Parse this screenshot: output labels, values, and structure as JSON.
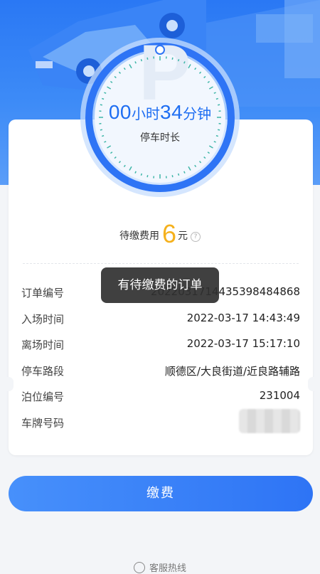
{
  "parking": {
    "duration_hours": "00",
    "duration_hours_unit": "小时",
    "duration_minutes": "34",
    "duration_minutes_unit": "分钟",
    "duration_label": "停车时长"
  },
  "fee": {
    "label": "待缴费用",
    "amount": "6",
    "unit": "元",
    "help_icon": "question-circle-icon"
  },
  "order": {
    "rows": [
      {
        "label": "订单编号",
        "value": "20220317144353984848​68"
      },
      {
        "label": "入场时间",
        "value": "2022-03-17 14:43:49"
      },
      {
        "label": "离场时间",
        "value": "2022-03-17 15:17:10"
      },
      {
        "label": "停车路段",
        "value": "顺德区/大良街道/近良路辅路"
      },
      {
        "label": "泊位编号",
        "value": "231004"
      },
      {
        "label": "车牌号码",
        "value": ""
      }
    ]
  },
  "toast": {
    "text": "有待缴费的订单"
  },
  "actions": {
    "pay_label": "缴费"
  },
  "footer": {
    "hotline_label": "客服热线",
    "hotline_icon": "phone-icon"
  },
  "colors": {
    "primary": "#2e74f5",
    "fee_amount": "#f5b11d",
    "duration": "#1e6ef2"
  }
}
